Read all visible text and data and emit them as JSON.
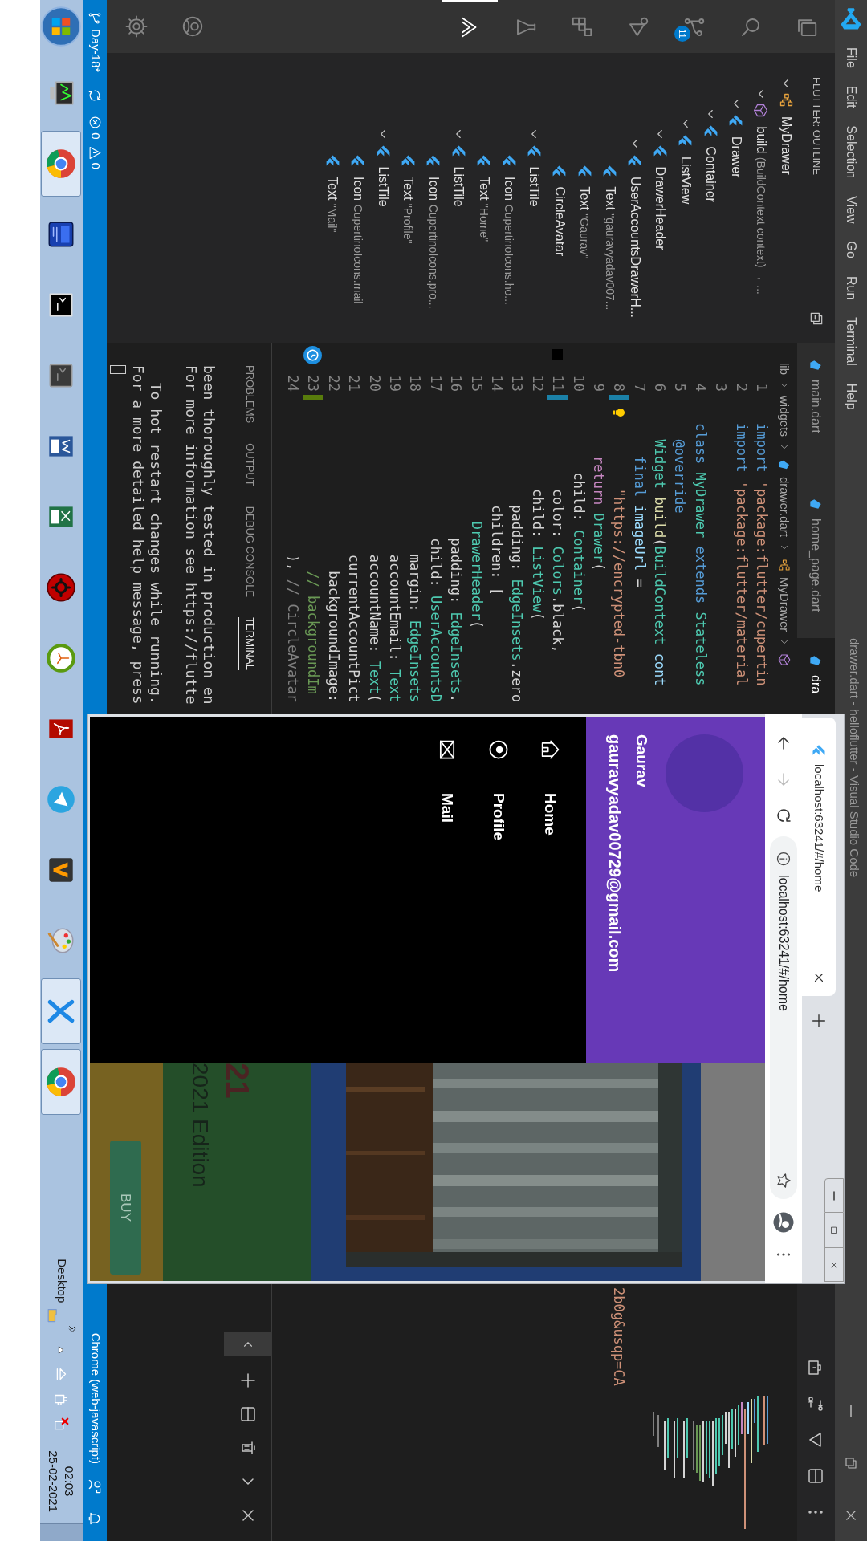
{
  "title_bar": {
    "menu": [
      "File",
      "Edit",
      "Selection",
      "View",
      "Go",
      "Run",
      "Terminal",
      "Help"
    ],
    "title": "drawer.dart - helloflutter - Visual Studio Code"
  },
  "activity_bar": [
    {
      "kind": "explorer",
      "selected": false
    },
    {
      "kind": "search",
      "selected": false
    },
    {
      "kind": "source-control",
      "selected": false,
      "badge": "11"
    },
    {
      "kind": "debug",
      "selected": false
    },
    {
      "kind": "extensions",
      "selected": false
    },
    {
      "kind": "testing",
      "selected": false
    },
    {
      "kind": "flutter",
      "selected": true
    }
  ],
  "sidebar": {
    "title": "FLUTTER: OUTLINE",
    "outline": [
      {
        "kind": "class",
        "name": "MyDrawer",
        "expanded": true,
        "children": [
          {
            "kind": "method",
            "name": "build",
            "detail": "(BuildContext context) → ...",
            "expanded": true,
            "children": [
              {
                "kind": "widget",
                "name": "Drawer",
                "expanded": true,
                "children": [
                  {
                    "kind": "widget",
                    "name": "Container",
                    "expanded": true,
                    "children": [
                      {
                        "kind": "widget",
                        "name": "ListView",
                        "expanded": true,
                        "children": [
                          {
                            "kind": "widget",
                            "name": "DrawerHeader",
                            "expanded": true,
                            "children": [
                              {
                                "kind": "widget",
                                "name": "UserAccountsDrawerH...",
                                "expanded": true,
                                "children": [
                                  {
                                    "kind": "widget",
                                    "name": "Text",
                                    "detail": "\"gauravyadav007..."
                                  },
                                  {
                                    "kind": "widget",
                                    "name": "Text",
                                    "detail": "\"Gaurav\""
                                  },
                                  {
                                    "kind": "widget",
                                    "name": "CircleAvatar"
                                  }
                                ]
                              }
                            ]
                          },
                          {
                            "kind": "widget",
                            "name": "ListTile",
                            "expanded": true,
                            "children": [
                              {
                                "kind": "widget",
                                "name": "Icon",
                                "detail": "CupertinoIcons.ho..."
                              },
                              {
                                "kind": "widget",
                                "name": "Text",
                                "detail": "\"Home\""
                              }
                            ]
                          },
                          {
                            "kind": "widget",
                            "name": "ListTile",
                            "expanded": true,
                            "children": [
                              {
                                "kind": "widget",
                                "name": "Icon",
                                "detail": "CupertinoIcons.pro..."
                              },
                              {
                                "kind": "widget",
                                "name": "Text",
                                "detail": "\"Profile\""
                              }
                            ]
                          },
                          {
                            "kind": "widget",
                            "name": "ListTile",
                            "expanded": true,
                            "children": [
                              {
                                "kind": "widget",
                                "name": "Icon",
                                "detail": "CupertinoIcons.mail"
                              },
                              {
                                "kind": "widget",
                                "name": "Text",
                                "detail": "\"Mail\""
                              }
                            ]
                          }
                        ]
                      }
                    ]
                  }
                ]
              }
            ]
          }
        ]
      }
    ]
  },
  "editor": {
    "tabs": [
      {
        "label": "main.dart",
        "selected": false
      },
      {
        "label": "home_page.dart",
        "selected": false
      },
      {
        "label": "dra",
        "selected": true
      }
    ],
    "breadcrumb": [
      {
        "kind": "folder",
        "text": "lib"
      },
      {
        "kind": "folder",
        "text": "widgets"
      },
      {
        "kind": "file",
        "text": "drawer.dart"
      },
      {
        "kind": "class",
        "text": "MyDrawer"
      },
      {
        "kind": "method"
      }
    ],
    "lines": [
      {
        "number": "1",
        "segments": [
          {
            "text": "import ",
            "kind": "kw"
          },
          {
            "text": "'package:flutter/cupertin",
            "kind": "str"
          }
        ]
      },
      {
        "number": "2",
        "segments": [
          {
            "text": "import ",
            "kind": "kw"
          },
          {
            "text": "'package:flutter/material",
            "kind": "str"
          }
        ]
      },
      {
        "number": "3"
      },
      {
        "number": "4",
        "segments": [
          {
            "text": "class ",
            "kind": "kw"
          },
          {
            "text": "MyDrawer ",
            "kind": "type"
          },
          {
            "text": "extends ",
            "kind": "kw"
          },
          {
            "text": "Stateless",
            "kind": "type"
          }
        ]
      },
      {
        "number": "5",
        "segments": [
          {
            "text": "  @override",
            "kind": "kw"
          }
        ]
      },
      {
        "number": "6",
        "segments": [
          {
            "text": "  Widget ",
            "kind": "type"
          },
          {
            "text": "build",
            "kind": "fn"
          },
          {
            "text": "(",
            "kind": "plain"
          },
          {
            "text": "BuildContext ",
            "kind": "type"
          },
          {
            "text": "cont",
            "kind": "var"
          }
        ]
      },
      {
        "number": "7",
        "segments": [
          {
            "text": "    final ",
            "kind": "kw"
          },
          {
            "text": "imageUrl ",
            "kind": "var"
          },
          {
            "text": "=",
            "kind": "plain"
          }
        ]
      },
      {
        "number": "8",
        "modified": true,
        "bulb": true,
        "segments": [
          {
            "text": "        \"https://encrypted-tbn0",
            "kind": "str"
          }
        ],
        "tail": "2b0g&usqp=CA"
      },
      {
        "number": "9",
        "segments": [
          {
            "text": "    return ",
            "kind": "ctl"
          },
          {
            "text": "Drawer",
            "kind": "type"
          },
          {
            "text": "(",
            "kind": "plain"
          }
        ]
      },
      {
        "number": "10",
        "segments": [
          {
            "text": "      child: ",
            "kind": "plain"
          },
          {
            "text": "Container",
            "kind": "type"
          },
          {
            "text": "(",
            "kind": "plain"
          }
        ]
      },
      {
        "number": "11",
        "modified": true,
        "color": "#000000",
        "segments": [
          {
            "text": "        color: ",
            "kind": "plain"
          },
          {
            "text": "Colors",
            "kind": "type"
          },
          {
            "text": ".black,",
            "kind": "plain"
          }
        ]
      },
      {
        "number": "12",
        "segments": [
          {
            "text": "        child: ",
            "kind": "plain"
          },
          {
            "text": "ListView",
            "kind": "type"
          },
          {
            "text": "(",
            "kind": "plain"
          }
        ]
      },
      {
        "number": "13",
        "segments": [
          {
            "text": "          padding: ",
            "kind": "plain"
          },
          {
            "text": "EdgeInsets",
            "kind": "type"
          },
          {
            "text": ".zero",
            "kind": "plain"
          }
        ]
      },
      {
        "number": "14",
        "segments": [
          {
            "text": "          children: [",
            "kind": "plain"
          }
        ]
      },
      {
        "number": "15",
        "segments": [
          {
            "text": "            DrawerHeader",
            "kind": "type"
          },
          {
            "text": "(",
            "kind": "plain"
          }
        ]
      },
      {
        "number": "16",
        "segments": [
          {
            "text": "              padding: ",
            "kind": "plain"
          },
          {
            "text": "EdgeInsets",
            "kind": "type"
          },
          {
            "text": ".",
            "kind": "plain"
          }
        ]
      },
      {
        "number": "17",
        "segments": [
          {
            "text": "              child: ",
            "kind": "plain"
          },
          {
            "text": "UserAccountsD",
            "kind": "type"
          }
        ]
      },
      {
        "number": "18",
        "segments": [
          {
            "text": "                margin: ",
            "kind": "plain"
          },
          {
            "text": "EdgeInsets",
            "kind": "type"
          }
        ]
      },
      {
        "number": "19",
        "segments": [
          {
            "text": "                accountEmail: ",
            "kind": "plain"
          },
          {
            "text": "Text",
            "kind": "type"
          }
        ]
      },
      {
        "number": "20",
        "segments": [
          {
            "text": "                accountName: ",
            "kind": "plain"
          },
          {
            "text": "Text",
            "kind": "type"
          },
          {
            "text": "(",
            "kind": "plain"
          }
        ]
      },
      {
        "number": "21",
        "segments": [
          {
            "text": "                currentAccountPict",
            "kind": "plain"
          }
        ]
      },
      {
        "number": "22",
        "segments": [
          {
            "text": "                  backgroundImage:",
            "kind": "plain"
          }
        ]
      },
      {
        "number": "23",
        "added": true,
        "icon": true,
        "segments": [
          {
            "text": "                  // backgroundIm",
            "kind": "cm"
          }
        ]
      },
      {
        "number": "24",
        "segments": [
          {
            "text": "                ), ",
            "kind": "plain"
          },
          {
            "text": "// CircleAvatar",
            "kind": "label"
          }
        ]
      }
    ]
  },
  "panel": {
    "tabs": [
      {
        "label": "PROBLEMS",
        "selected": false
      },
      {
        "label": "OUTPUT",
        "selected": false
      },
      {
        "label": "DEBUG CONSOLE",
        "selected": false
      },
      {
        "label": "TERMINAL",
        "selected": true
      }
    ],
    "terminal": [
      {
        "lines": [
          "been thoroughly tested in production en",
          "For more information see https://flutte"
        ]
      },
      {
        "lines": [
          "  To hot restart changes while running.",
          "For a more detailed help message, press"
        ]
      }
    ]
  },
  "status_bar": {
    "branch": "Day-18*",
    "errors": "0",
    "warnings": "0",
    "language": "Chrome (web-javascript)"
  },
  "browser": {
    "tab_title": "localhost:63241/#/home",
    "address": "localhost:63241/#/home",
    "back_enabled": true,
    "forward_enabled": false,
    "drawer": {
      "name": "Gaurav",
      "email": "gauravyadav00729@gmail.com",
      "items": [
        {
          "kind": "home",
          "label": "Home"
        },
        {
          "kind": "profile",
          "label": "Profile"
        },
        {
          "kind": "mail",
          "label": "Mail"
        }
      ]
    },
    "page": {
      "heading": "21",
      "subtitle": "2021 Edition",
      "button": "BUY"
    }
  },
  "taskbar": {
    "apps": [
      {
        "kind": "monitor",
        "active": false
      },
      {
        "kind": "browser",
        "active": true
      },
      {
        "kind": "ide",
        "active": false
      },
      {
        "kind": "terminal",
        "active": false
      },
      {
        "kind": "terminal-grey",
        "active": false
      },
      {
        "kind": "document",
        "active": false
      },
      {
        "kind": "spreadsheet",
        "active": false
      },
      {
        "kind": "gear",
        "active": false
      },
      {
        "kind": "clock",
        "active": false
      },
      {
        "kind": "pdf",
        "active": false
      },
      {
        "kind": "plane",
        "active": false
      },
      {
        "kind": "zigzag",
        "active": false
      },
      {
        "kind": "palette",
        "active": false
      },
      {
        "kind": "editor",
        "active": true
      },
      {
        "kind": "browser",
        "active": true
      }
    ],
    "desktop_label": "Desktop",
    "time": "02:03",
    "date": "25-02-2021"
  }
}
